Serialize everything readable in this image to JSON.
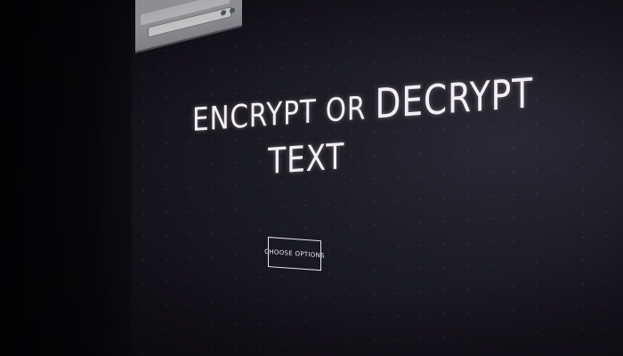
{
  "page": {
    "headline_line1_a": "ENCRYPT OR ",
    "headline_line1_b": "DECRYPT",
    "headline_line2": "TEXT",
    "choose_button_label": "CHOOSE OPTIONS"
  },
  "colors": {
    "screen_background": "#1d1c24",
    "text": "#f2f0f4",
    "bezel": "#050507"
  }
}
